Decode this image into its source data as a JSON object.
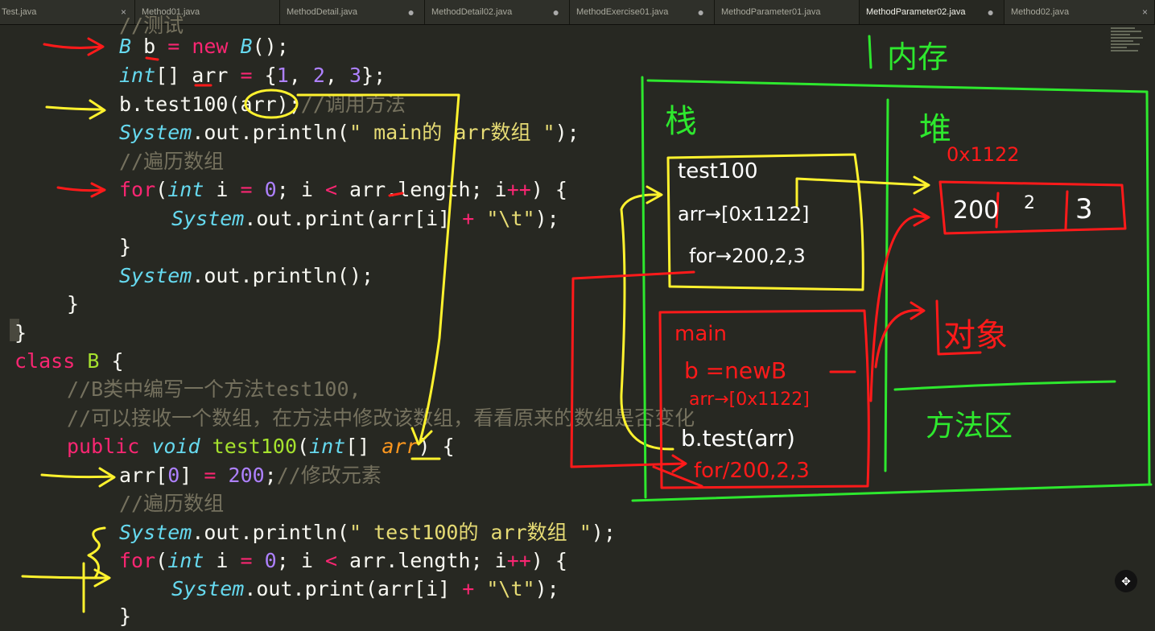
{
  "tabs": [
    {
      "label": "Test.java",
      "marker": "×"
    },
    {
      "label": "Method01.java",
      "marker": ""
    },
    {
      "label": "MethodDetail.java",
      "marker": "●"
    },
    {
      "label": "MethodDetail02.java",
      "marker": "●"
    },
    {
      "label": "MethodExercise01.java",
      "marker": "●"
    },
    {
      "label": "MethodParameter01.java",
      "marker": ""
    },
    {
      "label": "MethodParameter02.java",
      "marker": "●"
    },
    {
      "label": "Method02.java",
      "marker": "×"
    }
  ],
  "code": {
    "l1_cm": "//测试",
    "l2": {
      "t1": "B",
      "t2": " b ",
      "op": "=",
      "kw": " new ",
      "t3": "B",
      "t4": "();"
    },
    "l3": {
      "ty": "int",
      "t1": "[] arr ",
      "op": "=",
      "t2": " {",
      "n1": "1",
      "c1": ", ",
      "n2": "2",
      "c2": ", ",
      "n3": "3",
      "t3": "};"
    },
    "l4": {
      "t1": "b.test100(arr);",
      "cm": "//调用方法"
    },
    "l5": {
      "cls": "System",
      "t1": ".out.println(",
      "str": "\" main的 arr数组 \"",
      "t2": ");"
    },
    "l6_cm": "//遍历数组",
    "l7": {
      "kw": "for",
      "t1": "(",
      "ty": "int",
      "t2": " i ",
      "op1": "=",
      "sp1": " ",
      "n1": "0",
      "t3": "; i ",
      "op2": "<",
      "t4": " arr.length; i",
      "op3": "++",
      "t5": ") {"
    },
    "l8": {
      "cls": "System",
      "t1": ".out.print(arr[i] ",
      "op": "+",
      "sp": " ",
      "str": "\"\\t\"",
      "t2": ");"
    },
    "l9": "}",
    "l10": {
      "cls": "System",
      "t1": ".out.println();"
    },
    "l11": "}",
    "l12": "}",
    "l13": {
      "kw": "class",
      "sp": " ",
      "fn": "B",
      "t1": " {"
    },
    "l14_cm": "//B类中编写一个方法test100,",
    "l15_cm": "//可以接收一个数组，在方法中修改该数组，看看原来的数组是否变化",
    "l16": {
      "kw": "public",
      "sp1": " ",
      "ty1": "void",
      "sp2": " ",
      "fn": "test100",
      "t1": "(",
      "ty2": "int",
      "t2": "[] ",
      "param": "arr",
      "t3": ") {"
    },
    "l17": {
      "t1": "arr[",
      "n1": "0",
      "t2": "] ",
      "op": "=",
      "sp": " ",
      "n2": "200",
      "t3": ";",
      "cm": "//修改元素"
    },
    "l18_cm": "//遍历数组",
    "l19": {
      "cls": "System",
      "t1": ".out.println(",
      "str": "\" test100的 arr数组 \"",
      "t2": ");"
    },
    "l20": {
      "kw": "for",
      "t1": "(",
      "ty": "int",
      "t2": " i ",
      "op1": "=",
      "sp1": " ",
      "n1": "0",
      "t3": "; i ",
      "op2": "<",
      "t4": " arr.length; i",
      "op3": "++",
      "t5": ") {"
    },
    "l21": {
      "cls": "System",
      "t1": ".out.print(arr[i] ",
      "op": "+",
      "sp": " ",
      "str": "\"\\t\"",
      "t2": ");"
    },
    "l22": "}"
  },
  "annotations": {
    "memory": "内存",
    "stack": "栈",
    "heap": "堆",
    "heap_address": "0x1122",
    "heap_cells": [
      "200",
      "2",
      "3"
    ],
    "object": "对象",
    "method_area": "方法区",
    "frame_test100": [
      "test100",
      "arr→[0x1122]",
      "for→200,2,3"
    ],
    "frame_main": [
      "main",
      "b =newB",
      "arr→[0x1122]",
      "b.test(arr)",
      "for/200,2,3"
    ]
  },
  "colors": {
    "red": "#ff1a1a",
    "yellow": "#fff22e",
    "green": "#2ee82e"
  },
  "icons": {
    "move": "move-icon"
  }
}
